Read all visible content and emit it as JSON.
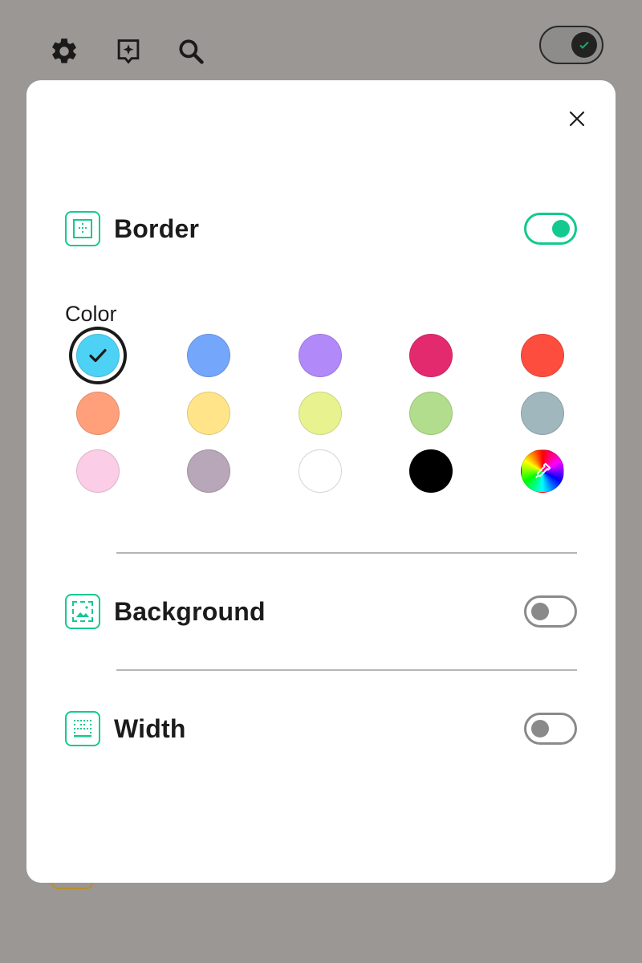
{
  "toolbar": {
    "icons": [
      "gear-icon",
      "bookmark-sparkle-icon",
      "search-icon"
    ],
    "mode_toggle_on": true
  },
  "modal": {
    "close_icon": "close-icon",
    "sections": {
      "border": {
        "title": "Border",
        "icon": "border-style-icon",
        "enabled": true
      },
      "background": {
        "title": "Background",
        "icon": "background-image-icon",
        "enabled": false
      },
      "width": {
        "title": "Width",
        "icon": "border-width-icon",
        "enabled": false
      }
    },
    "color": {
      "label": "Color",
      "selected_index": 0,
      "swatches": [
        "#4dd2f5",
        "#74a6fb",
        "#b189f9",
        "#e42a6e",
        "#fc4d3e",
        "#ffa07a",
        "#ffe48a",
        "#e8f38f",
        "#b2dd8c",
        "#9fb7bd",
        "#fbcde6",
        "#b8a7b8",
        "#ffffff",
        "#000000",
        "custom-color-picker"
      ]
    }
  },
  "colors": {
    "accent": "#14c98f",
    "overlay": "#9a9794"
  }
}
